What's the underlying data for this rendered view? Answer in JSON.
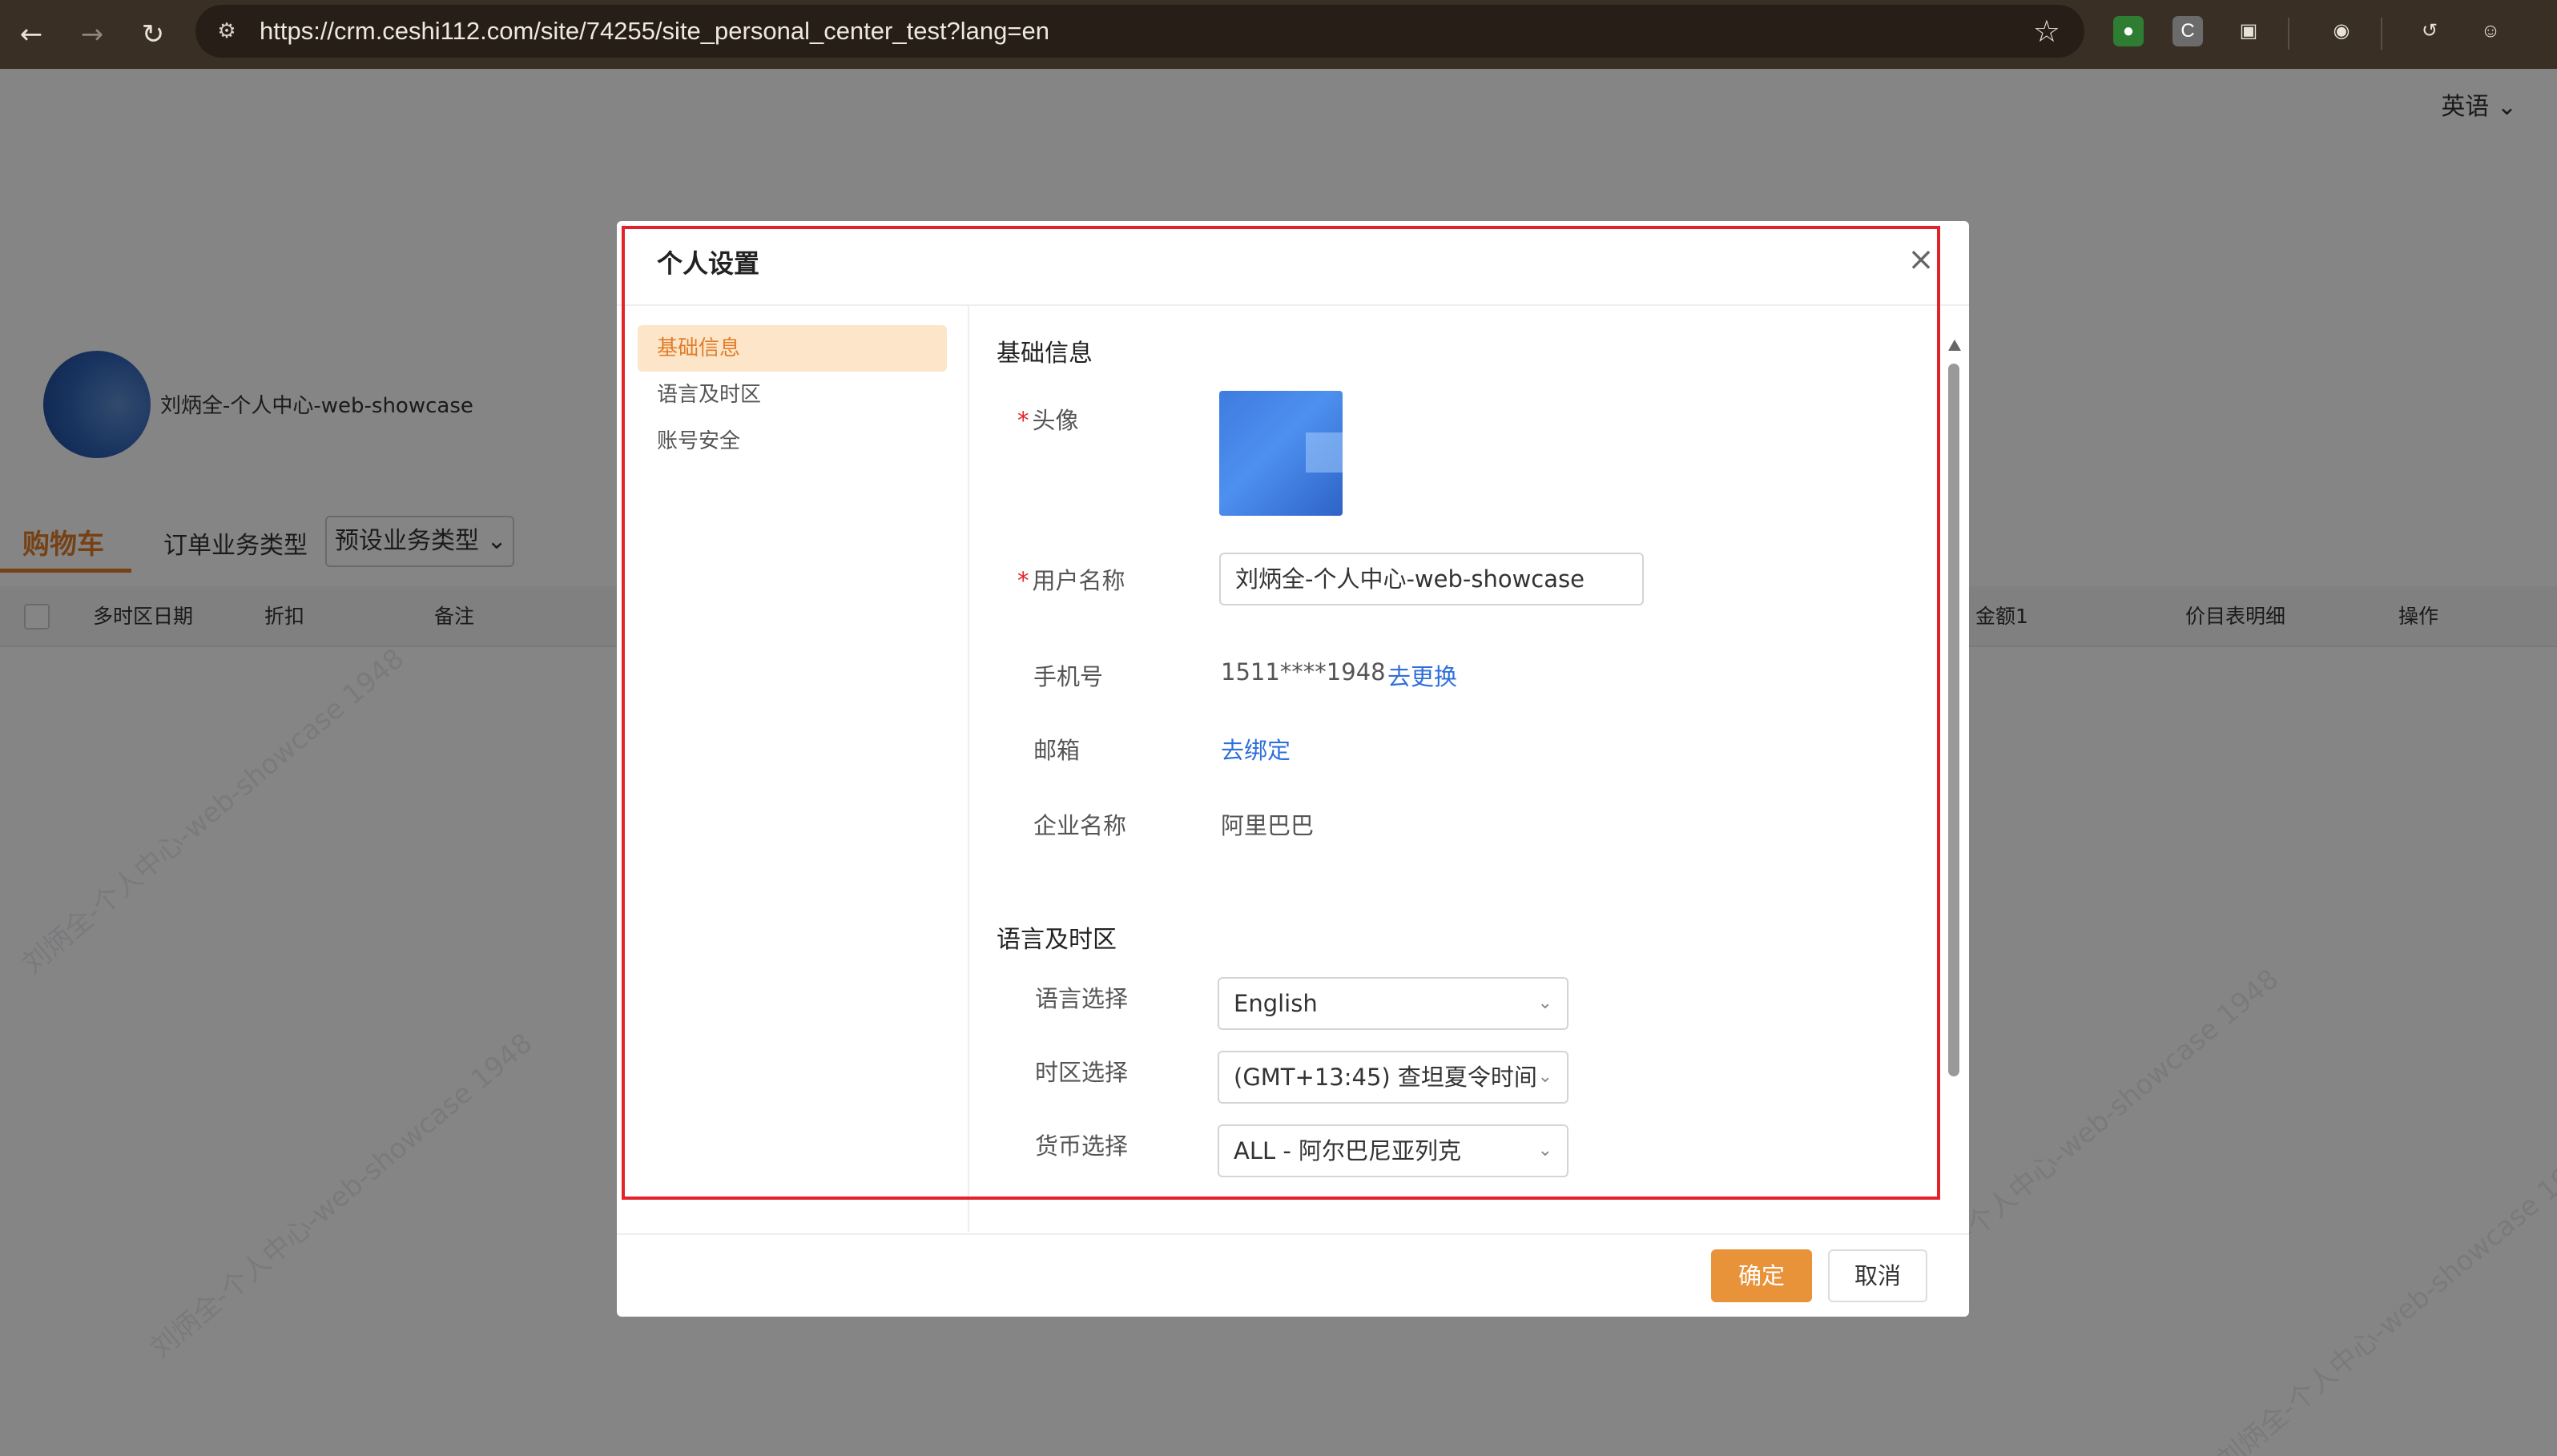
{
  "browser": {
    "url": "https://crm.ceshi112.com/site/74255/site_personal_center_test?lang=en",
    "ext_c_label": "C"
  },
  "background": {
    "language_switch": "英语",
    "user_name": "刘炳全-个人中心-web-showcase",
    "tab_cart": "购物车",
    "order_business_type": "订单业务类型",
    "preset_business_type": "预设业务类型",
    "table_headers": [
      "多时区日期",
      "折扣",
      "备注",
      "金额1",
      "价目表明细",
      "操作"
    ],
    "watermark_text": "刘炳全-个人中心-web-showcase 1948"
  },
  "dialog": {
    "title": "个人设置",
    "sidebar": [
      {
        "label": "基础信息",
        "active": true
      },
      {
        "label": "语言及时区",
        "active": false
      },
      {
        "label": "账号安全",
        "active": false
      }
    ],
    "basic_section_title": "基础信息",
    "required_mark": "*",
    "avatar_label": "头像",
    "username_label": "用户名称",
    "username_value": "刘炳全-个人中心-web-showcase",
    "phone_label": "手机号",
    "phone_value": "1511****1948",
    "phone_change_link": "去更换",
    "email_label": "邮箱",
    "email_bind_link": "去绑定",
    "company_label": "企业名称",
    "company_value": "阿里巴巴",
    "lang_section_title": "语言及时区",
    "language_label": "语言选择",
    "language_value": "English",
    "timezone_label": "时区选择",
    "timezone_value": "(GMT+13:45) 查坦夏令时间",
    "currency_label": "货币选择",
    "currency_value": "ALL - 阿尔巴尼亚列克",
    "confirm_button": "确定",
    "cancel_button": "取消"
  }
}
